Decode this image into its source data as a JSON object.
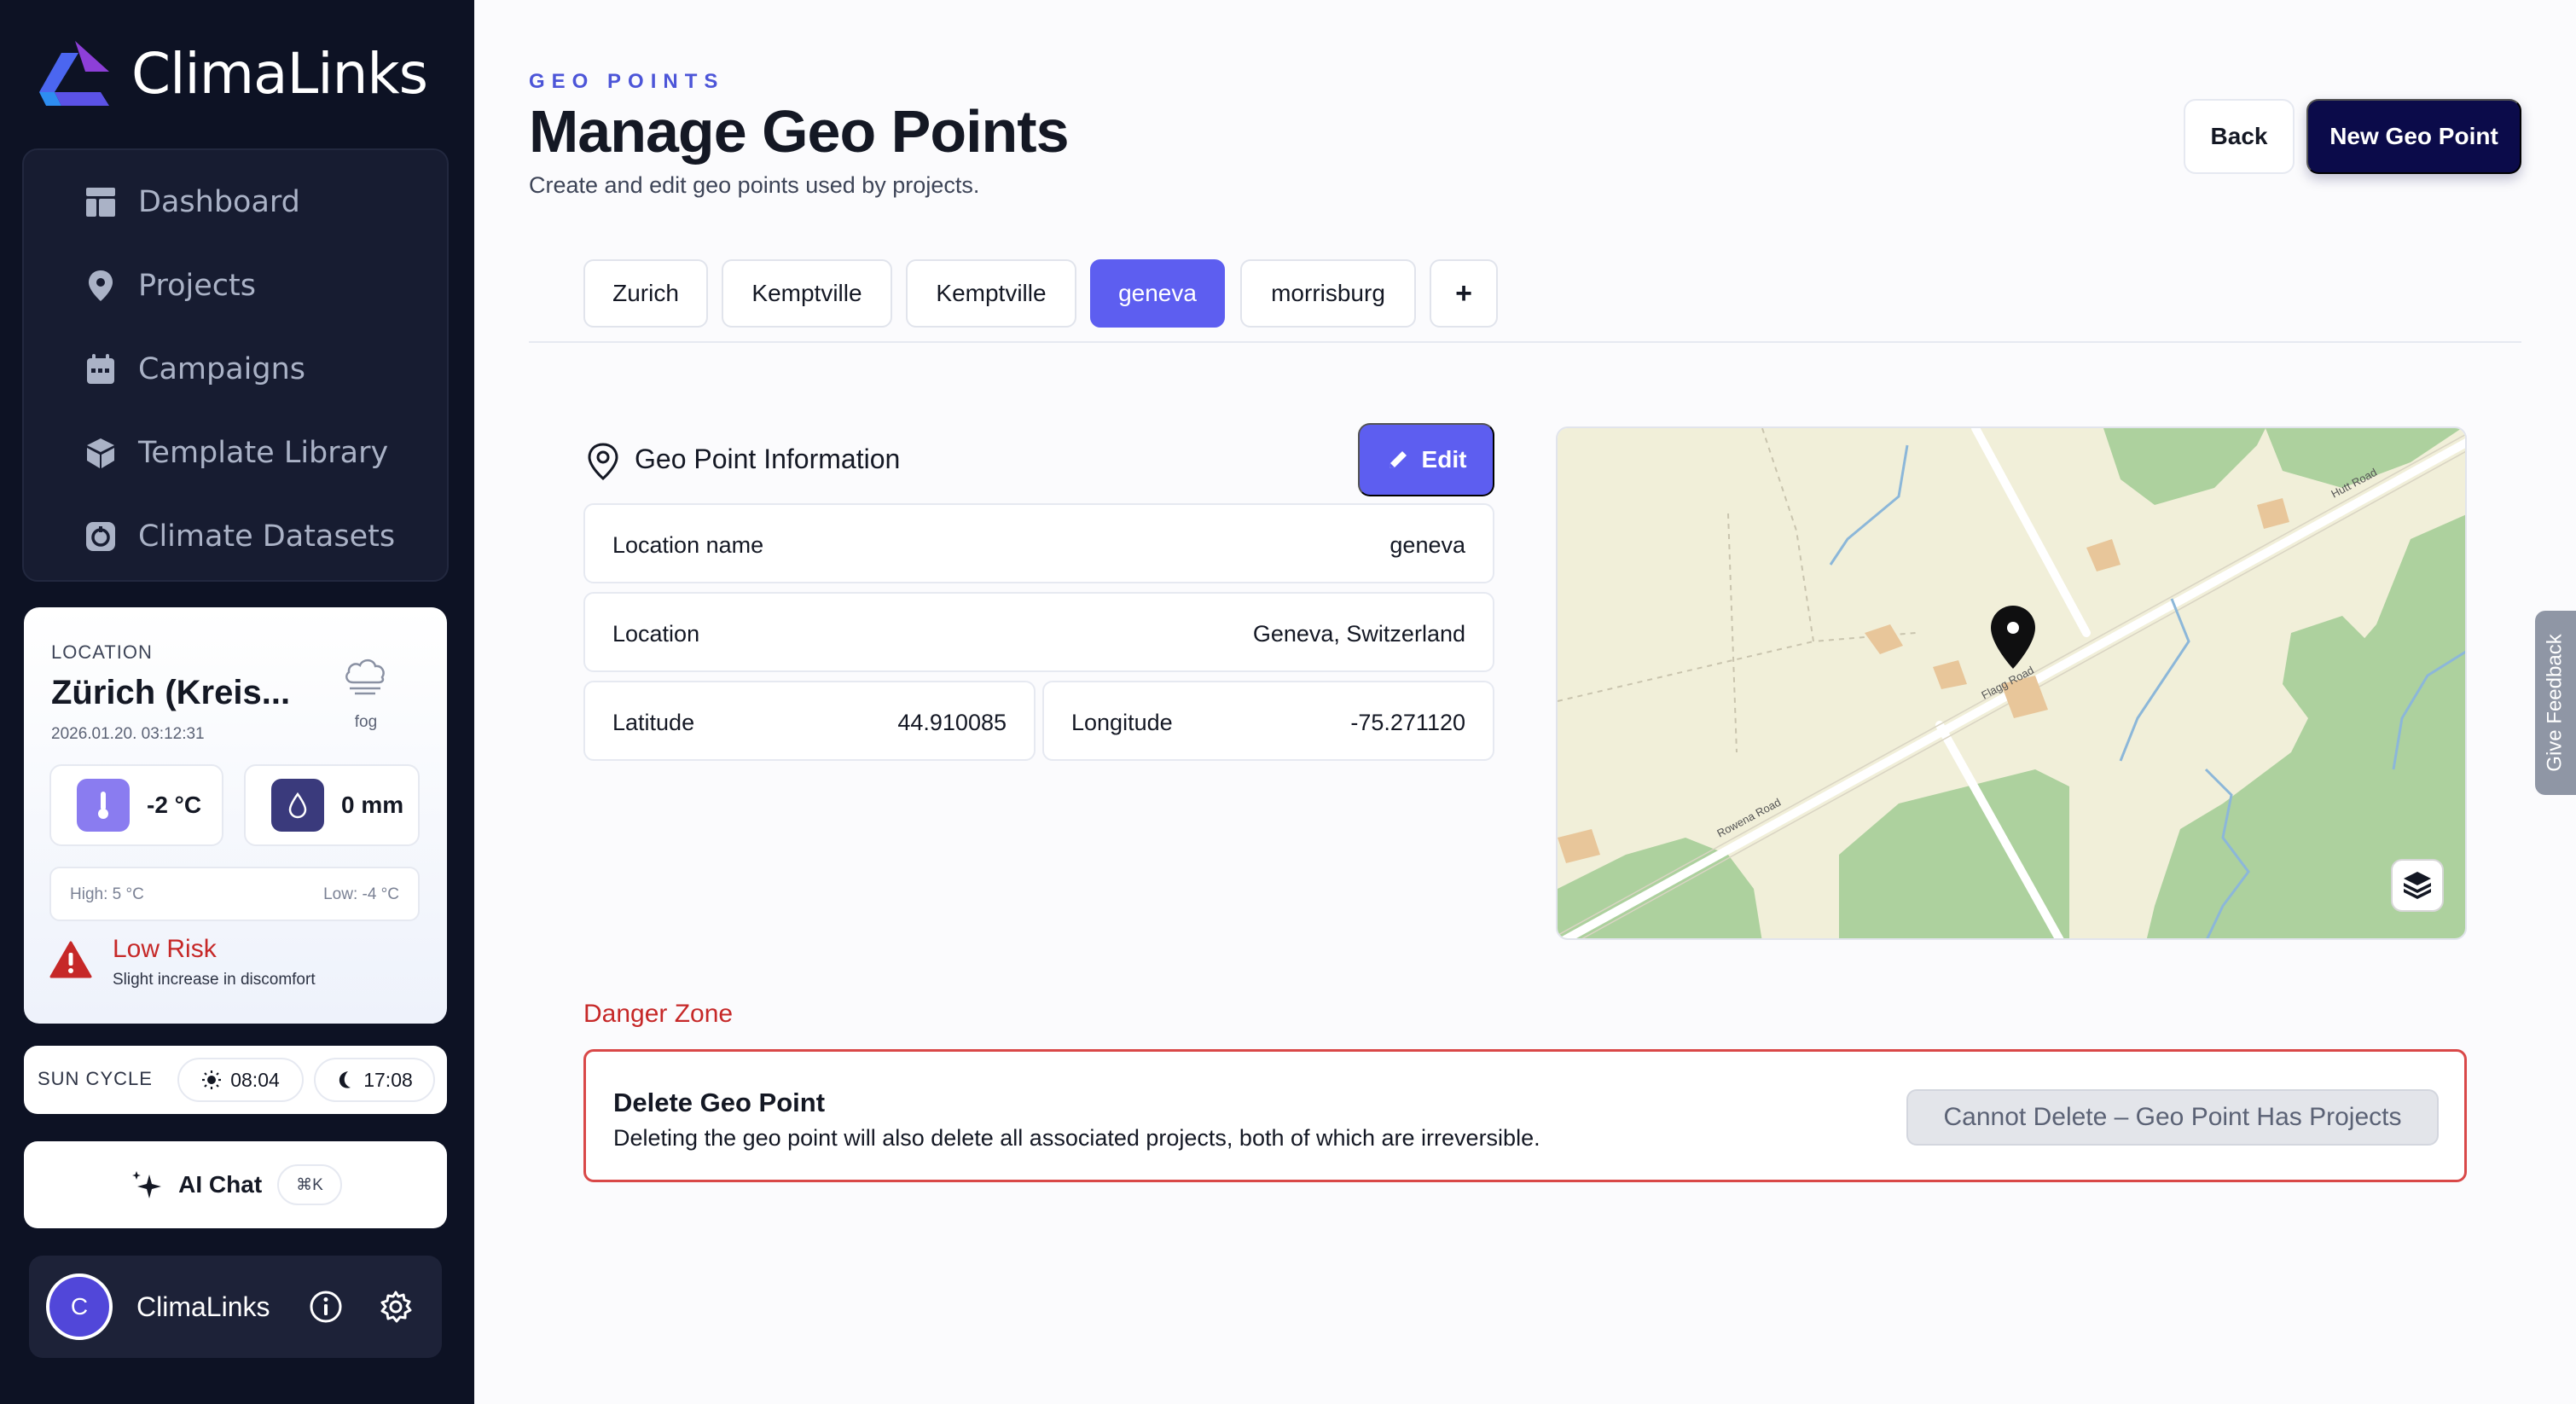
{
  "brand": {
    "name": "ClimaLinks"
  },
  "sidebar": {
    "items": [
      {
        "label": "Dashboard",
        "icon": "dashboard-icon"
      },
      {
        "label": "Projects",
        "icon": "map-pin-icon"
      },
      {
        "label": "Campaigns",
        "icon": "calendar-icon"
      },
      {
        "label": "Template Library",
        "icon": "cube-icon"
      },
      {
        "label": "Climate Datasets",
        "icon": "dataset-icon"
      }
    ]
  },
  "weather": {
    "location_label": "LOCATION",
    "city": "Zürich (Kreis...",
    "timestamp": "2026.01.20. 03:12:31",
    "condition": "fog",
    "temperature": "-2 °C",
    "precipitation": "0 mm",
    "high": "High: 5 °C",
    "low": "Low: -4 °C",
    "risk_title": "Low Risk",
    "risk_sub": "Slight increase in discomfort"
  },
  "sun_cycle": {
    "label": "SUN CYCLE",
    "sunrise": "08:04",
    "sunset": "17:08"
  },
  "ai_chat": {
    "label": "AI Chat",
    "shortcut": "⌘K"
  },
  "user": {
    "initial": "C",
    "name": "ClimaLinks"
  },
  "header": {
    "eyebrow": "GEO POINTS",
    "title": "Manage Geo Points",
    "subtitle": "Create and edit geo points used by projects.",
    "back_label": "Back",
    "new_label": "New Geo Point"
  },
  "tabs": [
    {
      "label": "Zurich"
    },
    {
      "label": "Kemptville"
    },
    {
      "label": "Kemptville"
    },
    {
      "label": "geneva",
      "active": true
    },
    {
      "label": "morrisburg"
    },
    {
      "label": "+"
    }
  ],
  "info": {
    "heading": "Geo Point Information",
    "edit_label": "Edit",
    "location_name_label": "Location name",
    "location_name_value": "geneva",
    "location_label": "Location",
    "location_value": "Geneva, Switzerland",
    "latitude_label": "Latitude",
    "latitude_value": "44.910085",
    "longitude_label": "Longitude",
    "longitude_value": "-75.271120"
  },
  "map": {
    "roads": [
      "Hutt Road",
      "Flagg Road",
      "Rowena Road"
    ]
  },
  "danger": {
    "zone_title": "Danger Zone",
    "title": "Delete Geo Point",
    "text": "Deleting the geo point will also delete all associated projects, both of which are irreversible.",
    "button_label": "Cannot Delete – Geo Point Has Projects"
  },
  "feedback": {
    "label": "Give Feedback"
  },
  "colors": {
    "sidebar_bg": "#0d1224",
    "accent": "#5d5ef0",
    "primary_dark": "#0b0b4a",
    "danger": "#c62828",
    "map_land": "#f1efd9",
    "map_forest": "#add19e"
  }
}
